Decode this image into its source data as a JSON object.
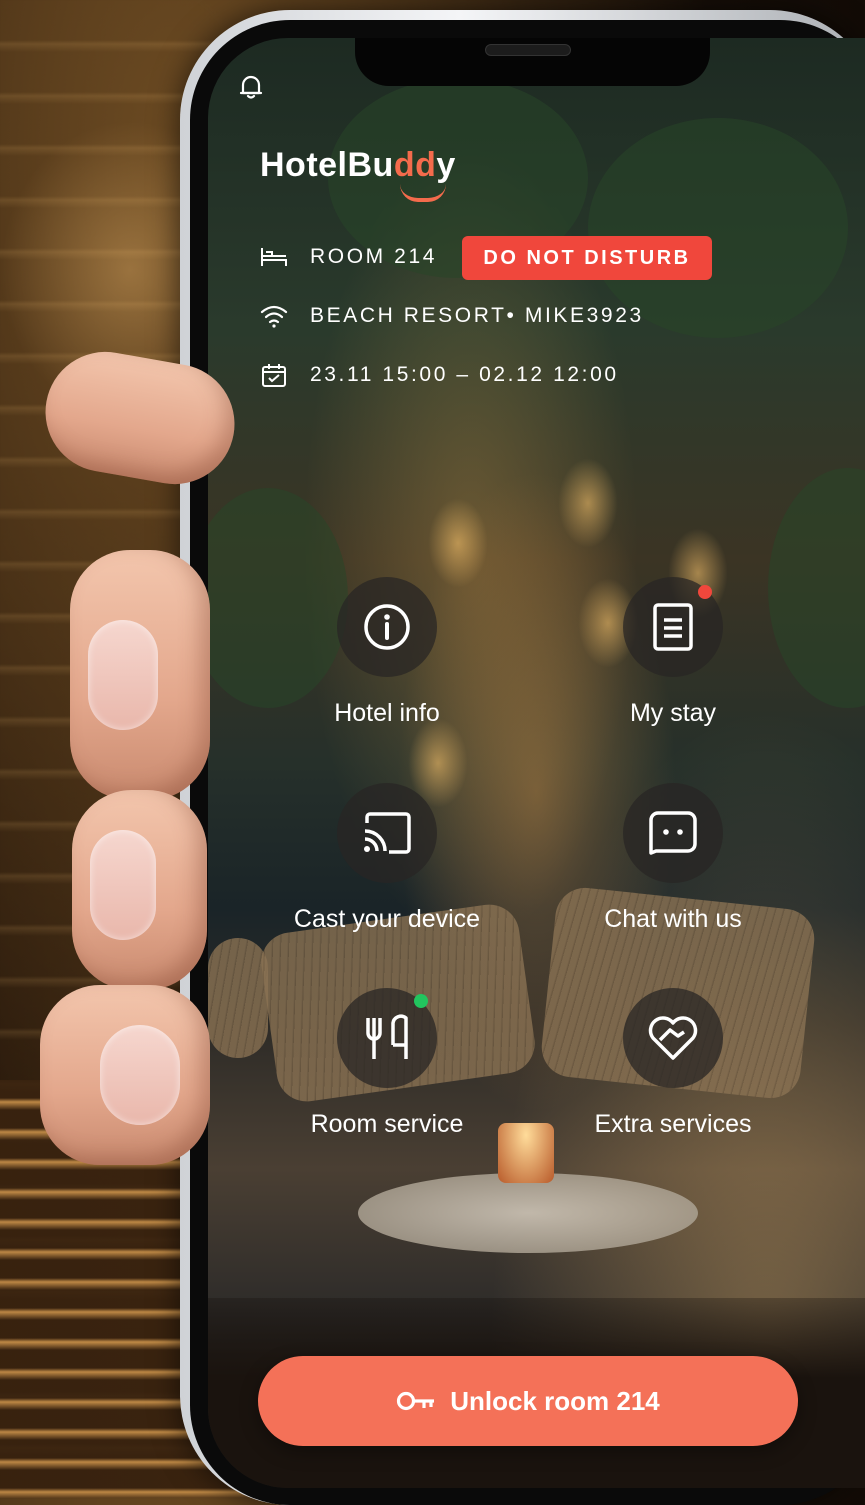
{
  "app": {
    "brand_prefix": "HotelBu",
    "brand_accent": "dd",
    "brand_suffix": "y",
    "accent_color": "#f46b4c"
  },
  "header": {
    "room_label": "ROOM 214",
    "dnd_label": "DO NOT DISTURB",
    "wifi_label": "BEACH RESORT• MIKE3923",
    "dates_label": "23.11 15:00 – 02.12 12:00"
  },
  "tiles": [
    {
      "label": "Hotel info",
      "icon": "info-icon"
    },
    {
      "label": "My stay",
      "icon": "document-icon",
      "badge": "red"
    },
    {
      "label": "Cast your device",
      "icon": "cast-icon"
    },
    {
      "label": "Chat with us",
      "icon": "chat-icon"
    },
    {
      "label": "Room service",
      "icon": "cutlery-icon",
      "badge": "green"
    },
    {
      "label": "Extra services",
      "icon": "heart-handshake-icon"
    }
  ],
  "unlock": {
    "label": "Unlock room 214",
    "icon": "key-icon"
  },
  "colors": {
    "dnd": "#f0473c",
    "unlock": "#f47158",
    "badge_red": "#f0473c",
    "badge_green": "#22c55e"
  }
}
